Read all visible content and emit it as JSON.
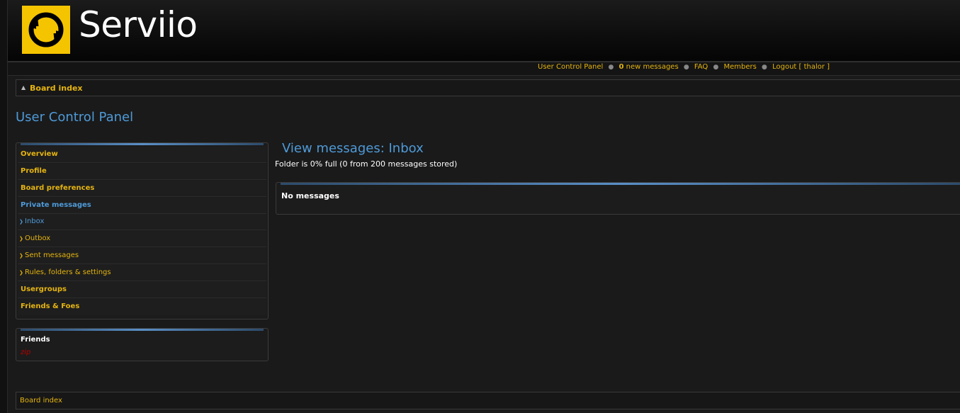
{
  "brand": {
    "name": "Serviio",
    "logo_color": "#f5c400"
  },
  "top_nav": {
    "user_control_panel": "User Control Panel",
    "new_messages_count": "0",
    "new_messages_label": "new messages",
    "faq": "FAQ",
    "members": "Members",
    "logout": "Logout [ thalor ]"
  },
  "breadcrumb": {
    "icon": "up-arrow-icon",
    "label": "Board index"
  },
  "page_title": "User Control Panel",
  "menu": {
    "items": [
      {
        "label": "Overview",
        "type": "major",
        "active": false
      },
      {
        "label": "Profile",
        "type": "major",
        "active": false
      },
      {
        "label": "Board preferences",
        "type": "major",
        "active": false
      },
      {
        "label": "Private messages",
        "type": "major",
        "active": true
      },
      {
        "label": "Inbox",
        "type": "sub",
        "active": true
      },
      {
        "label": "Outbox",
        "type": "sub",
        "active": false
      },
      {
        "label": "Sent messages",
        "type": "sub",
        "active": false
      },
      {
        "label": "Rules, folders & settings",
        "type": "sub",
        "active": false
      },
      {
        "label": "Usergroups",
        "type": "major",
        "active": false
      },
      {
        "label": "Friends & Foes",
        "type": "major",
        "active": false
      }
    ]
  },
  "friends": {
    "title": "Friends",
    "items": [
      "zip"
    ]
  },
  "main": {
    "title": "View messages: Inbox",
    "folder_status": "Folder is 0% full (0 from 200 messages stored)",
    "empty_text": "No messages"
  },
  "footer": {
    "label": "Board index"
  },
  "colors": {
    "link": "#e5b40f",
    "heading": "#4e9ad8",
    "online_friend": "#b40000"
  }
}
